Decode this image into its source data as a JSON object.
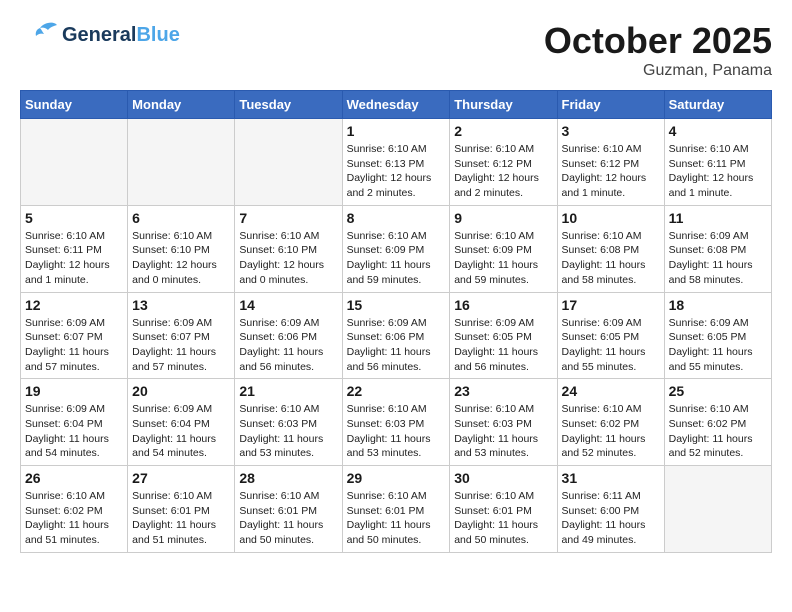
{
  "header": {
    "logo_general": "General",
    "logo_blue": "Blue",
    "month": "October 2025",
    "location": "Guzman, Panama"
  },
  "weekdays": [
    "Sunday",
    "Monday",
    "Tuesday",
    "Wednesday",
    "Thursday",
    "Friday",
    "Saturday"
  ],
  "weeks": [
    [
      {
        "day": "",
        "sunrise": "",
        "sunset": "",
        "daylight": "",
        "empty": true
      },
      {
        "day": "",
        "sunrise": "",
        "sunset": "",
        "daylight": "",
        "empty": true
      },
      {
        "day": "",
        "sunrise": "",
        "sunset": "",
        "daylight": "",
        "empty": true
      },
      {
        "day": "1",
        "sunrise": "Sunrise: 6:10 AM",
        "sunset": "Sunset: 6:13 PM",
        "daylight": "Daylight: 12 hours and 2 minutes.",
        "empty": false
      },
      {
        "day": "2",
        "sunrise": "Sunrise: 6:10 AM",
        "sunset": "Sunset: 6:12 PM",
        "daylight": "Daylight: 12 hours and 2 minutes.",
        "empty": false
      },
      {
        "day": "3",
        "sunrise": "Sunrise: 6:10 AM",
        "sunset": "Sunset: 6:12 PM",
        "daylight": "Daylight: 12 hours and 1 minute.",
        "empty": false
      },
      {
        "day": "4",
        "sunrise": "Sunrise: 6:10 AM",
        "sunset": "Sunset: 6:11 PM",
        "daylight": "Daylight: 12 hours and 1 minute.",
        "empty": false
      }
    ],
    [
      {
        "day": "5",
        "sunrise": "Sunrise: 6:10 AM",
        "sunset": "Sunset: 6:11 PM",
        "daylight": "Daylight: 12 hours and 1 minute.",
        "empty": false
      },
      {
        "day": "6",
        "sunrise": "Sunrise: 6:10 AM",
        "sunset": "Sunset: 6:10 PM",
        "daylight": "Daylight: 12 hours and 0 minutes.",
        "empty": false
      },
      {
        "day": "7",
        "sunrise": "Sunrise: 6:10 AM",
        "sunset": "Sunset: 6:10 PM",
        "daylight": "Daylight: 12 hours and 0 minutes.",
        "empty": false
      },
      {
        "day": "8",
        "sunrise": "Sunrise: 6:10 AM",
        "sunset": "Sunset: 6:09 PM",
        "daylight": "Daylight: 11 hours and 59 minutes.",
        "empty": false
      },
      {
        "day": "9",
        "sunrise": "Sunrise: 6:10 AM",
        "sunset": "Sunset: 6:09 PM",
        "daylight": "Daylight: 11 hours and 59 minutes.",
        "empty": false
      },
      {
        "day": "10",
        "sunrise": "Sunrise: 6:10 AM",
        "sunset": "Sunset: 6:08 PM",
        "daylight": "Daylight: 11 hours and 58 minutes.",
        "empty": false
      },
      {
        "day": "11",
        "sunrise": "Sunrise: 6:09 AM",
        "sunset": "Sunset: 6:08 PM",
        "daylight": "Daylight: 11 hours and 58 minutes.",
        "empty": false
      }
    ],
    [
      {
        "day": "12",
        "sunrise": "Sunrise: 6:09 AM",
        "sunset": "Sunset: 6:07 PM",
        "daylight": "Daylight: 11 hours and 57 minutes.",
        "empty": false
      },
      {
        "day": "13",
        "sunrise": "Sunrise: 6:09 AM",
        "sunset": "Sunset: 6:07 PM",
        "daylight": "Daylight: 11 hours and 57 minutes.",
        "empty": false
      },
      {
        "day": "14",
        "sunrise": "Sunrise: 6:09 AM",
        "sunset": "Sunset: 6:06 PM",
        "daylight": "Daylight: 11 hours and 56 minutes.",
        "empty": false
      },
      {
        "day": "15",
        "sunrise": "Sunrise: 6:09 AM",
        "sunset": "Sunset: 6:06 PM",
        "daylight": "Daylight: 11 hours and 56 minutes.",
        "empty": false
      },
      {
        "day": "16",
        "sunrise": "Sunrise: 6:09 AM",
        "sunset": "Sunset: 6:05 PM",
        "daylight": "Daylight: 11 hours and 56 minutes.",
        "empty": false
      },
      {
        "day": "17",
        "sunrise": "Sunrise: 6:09 AM",
        "sunset": "Sunset: 6:05 PM",
        "daylight": "Daylight: 11 hours and 55 minutes.",
        "empty": false
      },
      {
        "day": "18",
        "sunrise": "Sunrise: 6:09 AM",
        "sunset": "Sunset: 6:05 PM",
        "daylight": "Daylight: 11 hours and 55 minutes.",
        "empty": false
      }
    ],
    [
      {
        "day": "19",
        "sunrise": "Sunrise: 6:09 AM",
        "sunset": "Sunset: 6:04 PM",
        "daylight": "Daylight: 11 hours and 54 minutes.",
        "empty": false
      },
      {
        "day": "20",
        "sunrise": "Sunrise: 6:09 AM",
        "sunset": "Sunset: 6:04 PM",
        "daylight": "Daylight: 11 hours and 54 minutes.",
        "empty": false
      },
      {
        "day": "21",
        "sunrise": "Sunrise: 6:10 AM",
        "sunset": "Sunset: 6:03 PM",
        "daylight": "Daylight: 11 hours and 53 minutes.",
        "empty": false
      },
      {
        "day": "22",
        "sunrise": "Sunrise: 6:10 AM",
        "sunset": "Sunset: 6:03 PM",
        "daylight": "Daylight: 11 hours and 53 minutes.",
        "empty": false
      },
      {
        "day": "23",
        "sunrise": "Sunrise: 6:10 AM",
        "sunset": "Sunset: 6:03 PM",
        "daylight": "Daylight: 11 hours and 53 minutes.",
        "empty": false
      },
      {
        "day": "24",
        "sunrise": "Sunrise: 6:10 AM",
        "sunset": "Sunset: 6:02 PM",
        "daylight": "Daylight: 11 hours and 52 minutes.",
        "empty": false
      },
      {
        "day": "25",
        "sunrise": "Sunrise: 6:10 AM",
        "sunset": "Sunset: 6:02 PM",
        "daylight": "Daylight: 11 hours and 52 minutes.",
        "empty": false
      }
    ],
    [
      {
        "day": "26",
        "sunrise": "Sunrise: 6:10 AM",
        "sunset": "Sunset: 6:02 PM",
        "daylight": "Daylight: 11 hours and 51 minutes.",
        "empty": false
      },
      {
        "day": "27",
        "sunrise": "Sunrise: 6:10 AM",
        "sunset": "Sunset: 6:01 PM",
        "daylight": "Daylight: 11 hours and 51 minutes.",
        "empty": false
      },
      {
        "day": "28",
        "sunrise": "Sunrise: 6:10 AM",
        "sunset": "Sunset: 6:01 PM",
        "daylight": "Daylight: 11 hours and 50 minutes.",
        "empty": false
      },
      {
        "day": "29",
        "sunrise": "Sunrise: 6:10 AM",
        "sunset": "Sunset: 6:01 PM",
        "daylight": "Daylight: 11 hours and 50 minutes.",
        "empty": false
      },
      {
        "day": "30",
        "sunrise": "Sunrise: 6:10 AM",
        "sunset": "Sunset: 6:01 PM",
        "daylight": "Daylight: 11 hours and 50 minutes.",
        "empty": false
      },
      {
        "day": "31",
        "sunrise": "Sunrise: 6:11 AM",
        "sunset": "Sunset: 6:00 PM",
        "daylight": "Daylight: 11 hours and 49 minutes.",
        "empty": false
      },
      {
        "day": "",
        "sunrise": "",
        "sunset": "",
        "daylight": "",
        "empty": true
      }
    ]
  ]
}
